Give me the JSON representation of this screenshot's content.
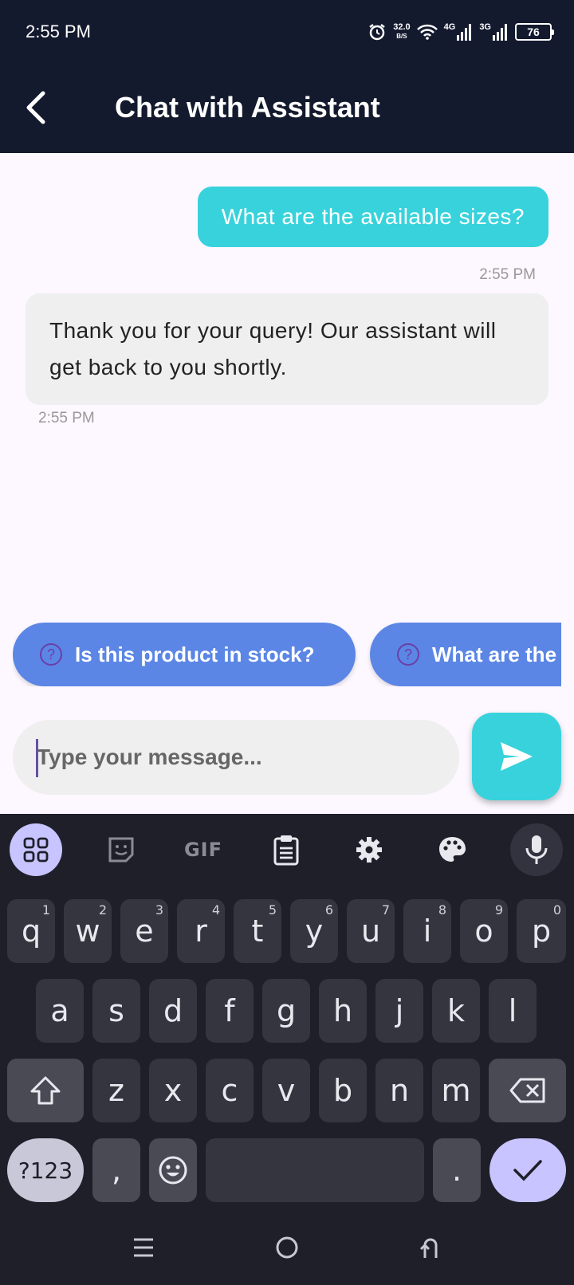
{
  "status_bar": {
    "time": "2:55 PM",
    "speed_value": "32.0",
    "speed_unit": "B/S",
    "net1": "4G",
    "net2": "3G",
    "battery": "76"
  },
  "app_bar": {
    "title": "Chat with Assistant"
  },
  "messages": [
    {
      "sender": "user",
      "text": "What are the available sizes?",
      "time": "2:55 PM"
    },
    {
      "sender": "assistant",
      "text": "Thank you for your query! Our assistant will get back to you shortly.",
      "time": "2:55 PM"
    }
  ],
  "suggestions": [
    {
      "label": "Is this product in stock?"
    },
    {
      "label": "What are the"
    }
  ],
  "input": {
    "placeholder": "Type your message...",
    "value": ""
  },
  "keyboard": {
    "toolbar": [
      "apps-icon",
      "sticker-icon",
      "GIF",
      "clipboard-icon",
      "settings-icon",
      "palette-icon",
      "mic-icon"
    ],
    "gif_label": "GIF",
    "row1": [
      "q",
      "w",
      "e",
      "r",
      "t",
      "y",
      "u",
      "i",
      "o",
      "p"
    ],
    "row1_hints": [
      "1",
      "2",
      "3",
      "4",
      "5",
      "6",
      "7",
      "8",
      "9",
      "0"
    ],
    "row2": [
      "a",
      "s",
      "d",
      "f",
      "g",
      "h",
      "j",
      "k",
      "l"
    ],
    "row3": [
      "z",
      "x",
      "c",
      "v",
      "b",
      "n",
      "m"
    ],
    "symbols_label": "?123",
    "comma": ",",
    "period": "."
  },
  "colors": {
    "accent": "#38d2dc",
    "chip": "#5b86e5",
    "header": "#141a2e"
  }
}
